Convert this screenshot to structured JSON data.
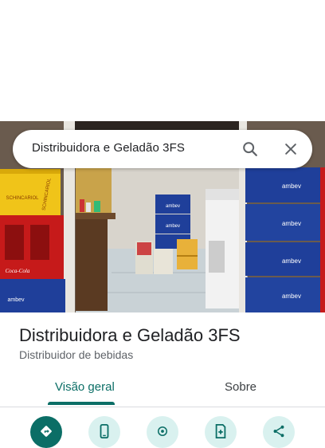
{
  "search": {
    "query": "Distribuidora e Geladão 3FS",
    "search_icon": "search-icon",
    "close_icon": "close-icon"
  },
  "place": {
    "name": "Distribuidora e Geladão 3FS",
    "category": "Distribuidor de bebidas"
  },
  "photo": {
    "crate_labels": {
      "left_top": "SCHINCARIOL",
      "left_red": "Coca-Cola",
      "left_blue": "ambev",
      "center_blue": "ambev",
      "right_blue": "ambev"
    }
  },
  "tabs": [
    {
      "label": "Visão geral",
      "active": true
    },
    {
      "label": "Sobre",
      "active": false
    }
  ],
  "actions": [
    {
      "icon": "directions-icon",
      "style": "primary"
    },
    {
      "icon": "phone-icon",
      "style": "secondary"
    },
    {
      "icon": "location-icon",
      "style": "secondary"
    },
    {
      "icon": "save-icon",
      "style": "secondary"
    },
    {
      "icon": "share-icon",
      "style": "secondary"
    }
  ],
  "colors": {
    "accent": "#0b6e66",
    "accent_light": "#d9f1ef",
    "text_primary": "#202124",
    "text_secondary": "#5f6368"
  }
}
